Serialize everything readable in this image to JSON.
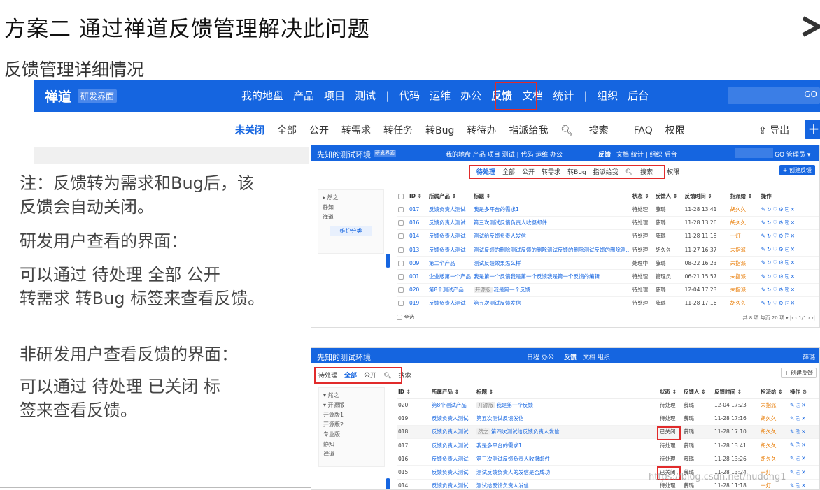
{
  "slide": {
    "title": "方案二  通过禅道反馈管理解决此问题",
    "subtitle": "反馈管理详细情况"
  },
  "notes": {
    "n1_line1": "注：反馈转为需求和Bug后，该",
    "n1_line2": "反馈会自动关闭。",
    "n2": "研发用户查看的界面：",
    "n3_line1": "可以通过   待处理  全部  公开",
    "n3_line2": "转需求  转Bug  标签来查看反馈。",
    "n4": "非研发用户查看反馈的界面：",
    "n5_line1": "可以通过    待处理  已关闭  标",
    "n5_line2": "签来查看反馈。"
  },
  "bignav": {
    "brand": "禅道",
    "tag": "研发界面",
    "menu": [
      "我的地盘",
      "产品",
      "项目",
      "测试"
    ],
    "menu2": [
      "代码",
      "运维",
      "办公"
    ],
    "active": "反馈",
    "menu3": [
      "文档",
      "统计"
    ],
    "menu4": [
      "组织",
      "后台"
    ],
    "search_btn": "GO"
  },
  "subnav": {
    "items": [
      "未关闭",
      "全部",
      "公开",
      "转需求",
      "转任务",
      "转Bug",
      "转待办",
      "指派给我"
    ],
    "search": "搜索",
    "faq": "FAQ",
    "perm": "权限",
    "export": "导出",
    "plus": "+"
  },
  "shot1": {
    "title": "先知的测试环境",
    "tag": "研发界面",
    "menu": "我的地盘  产品  项目  测试  |  代码  运维  办公",
    "active": "反馈",
    "menu_rest": "文档  统计  |  组织  后台",
    "right": "GO  管理员 ▾",
    "tabs": [
      "待处理",
      "全部",
      "公开",
      "转需求",
      "转Bug",
      "指派给我",
      "搜索",
      "权限"
    ],
    "create": "+ 创建反馈",
    "tree": [
      "▸ 然之",
      "  静知",
      "  禅道"
    ],
    "tree_btn": "维护分类",
    "headers": [
      "ID ⇕",
      "所属产品 ⇕",
      "标题 ⇕",
      "状态 ⇕",
      "反馈人 ⇕",
      "反馈时间 ⇕",
      "指派给 ⇕",
      "操作"
    ],
    "rows": [
      [
        "017",
        "反馈负责人测试",
        "我是多平台的需求1",
        "待处理",
        "薛璐",
        "11-28 13:41",
        "胡久久"
      ],
      [
        "016",
        "反馈负责人测试",
        "第三次测试反馈负责人收摄邮件",
        "待处理",
        "薛璐",
        "11-28 13:26",
        "胡久久"
      ],
      [
        "014",
        "反馈负责人测试",
        "测试给反馈负责人发信",
        "待处理",
        "薛璐",
        "11-28 11:18",
        "一灯"
      ],
      [
        "013",
        "反馈负责人测试",
        "测试反馈的删除测试反馈的删除测试反馈的删除测试反馈的删除测...",
        "待处理",
        "胡久久",
        "11-27 16:37",
        "未指派"
      ],
      [
        "009",
        "第二个产品",
        "测试反馈效果怎么样",
        "处理中",
        "薛璐",
        "08-22 16:23",
        "未指派"
      ],
      [
        "001",
        "企业版第一个产品",
        "我是第一个反馈我是第一个反馈我是第一个反馈的编辑",
        "待处理",
        "管理员",
        "06-21 15:57",
        "未指派"
      ],
      [
        "020",
        "第8个测试产品",
        "我是第一个反馈",
        "待处理",
        "薛璐",
        "12-04 17:23",
        "未指派"
      ],
      [
        "019",
        "反馈负责人测试",
        "第五次测试反馈发信",
        "待处理",
        "薛璐",
        "11-28 17:16",
        "胡久久"
      ]
    ],
    "row7_pill": "开源版",
    "select_all": "全选",
    "footer": "共 8 项  每页 20 项 ▾  |‹  ‹  1/1  ›  ›|"
  },
  "shot2": {
    "title": "先知的测试环境",
    "menu": "日程  办公",
    "active": "反馈",
    "menu_rest": "文档  组织",
    "user": "薛璐",
    "tabs": [
      "待处理",
      "全部",
      "公开",
      "搜索"
    ],
    "create": "+ 创建反馈",
    "tree": [
      "▾ 然之",
      "  ▾ 开源版",
      "      开源版1",
      "      开源版2",
      "    专业版",
      "  静知",
      "  禅道"
    ],
    "headers": [
      "ID ⇕",
      "所属产品 ⇕",
      "标题 ⇕",
      "状态 ⇕",
      "反馈人 ⇕",
      "反馈时间 ⇕",
      "指派给 ⇕",
      "操作 ⚙"
    ],
    "rows": [
      [
        "020",
        "第8个测试产品",
        "我是第一个反馈",
        "待处理",
        "薛璐",
        "12-04 17:23",
        "未指派"
      ],
      [
        "019",
        "反馈负责人测试",
        "第五次测试反馈发信",
        "待处理",
        "薛璐",
        "11-28 17:16",
        "胡久久"
      ],
      [
        "018",
        "反馈负责人测试",
        "第四次测试给反馈负责人发信",
        "已关闭",
        "薛璐",
        "11-28 17:10",
        "胡久久"
      ],
      [
        "017",
        "反馈负责人测试",
        "我是多平台的需求1",
        "待处理",
        "薛璐",
        "11-28 13:41",
        "胡久久"
      ],
      [
        "016",
        "反馈负责人测试",
        "第三次测试反馈负责人收摄邮件",
        "待处理",
        "薛璐",
        "11-28 13:26",
        "胡久久"
      ],
      [
        "015",
        "反馈负责人测试",
        "测试反馈负责人的发信是否成功",
        "已关闭",
        "薛璐",
        "11-28 13:24",
        "一灯"
      ],
      [
        "014",
        "反馈负责人测试",
        "测试给反馈负责人发信",
        "待处理",
        "薛璐",
        "11-28 11:18",
        "一灯"
      ]
    ],
    "row1_pill": "开源版",
    "row3_pill": "然之"
  },
  "watermark": "https://blog.csdn.net/hudong1"
}
